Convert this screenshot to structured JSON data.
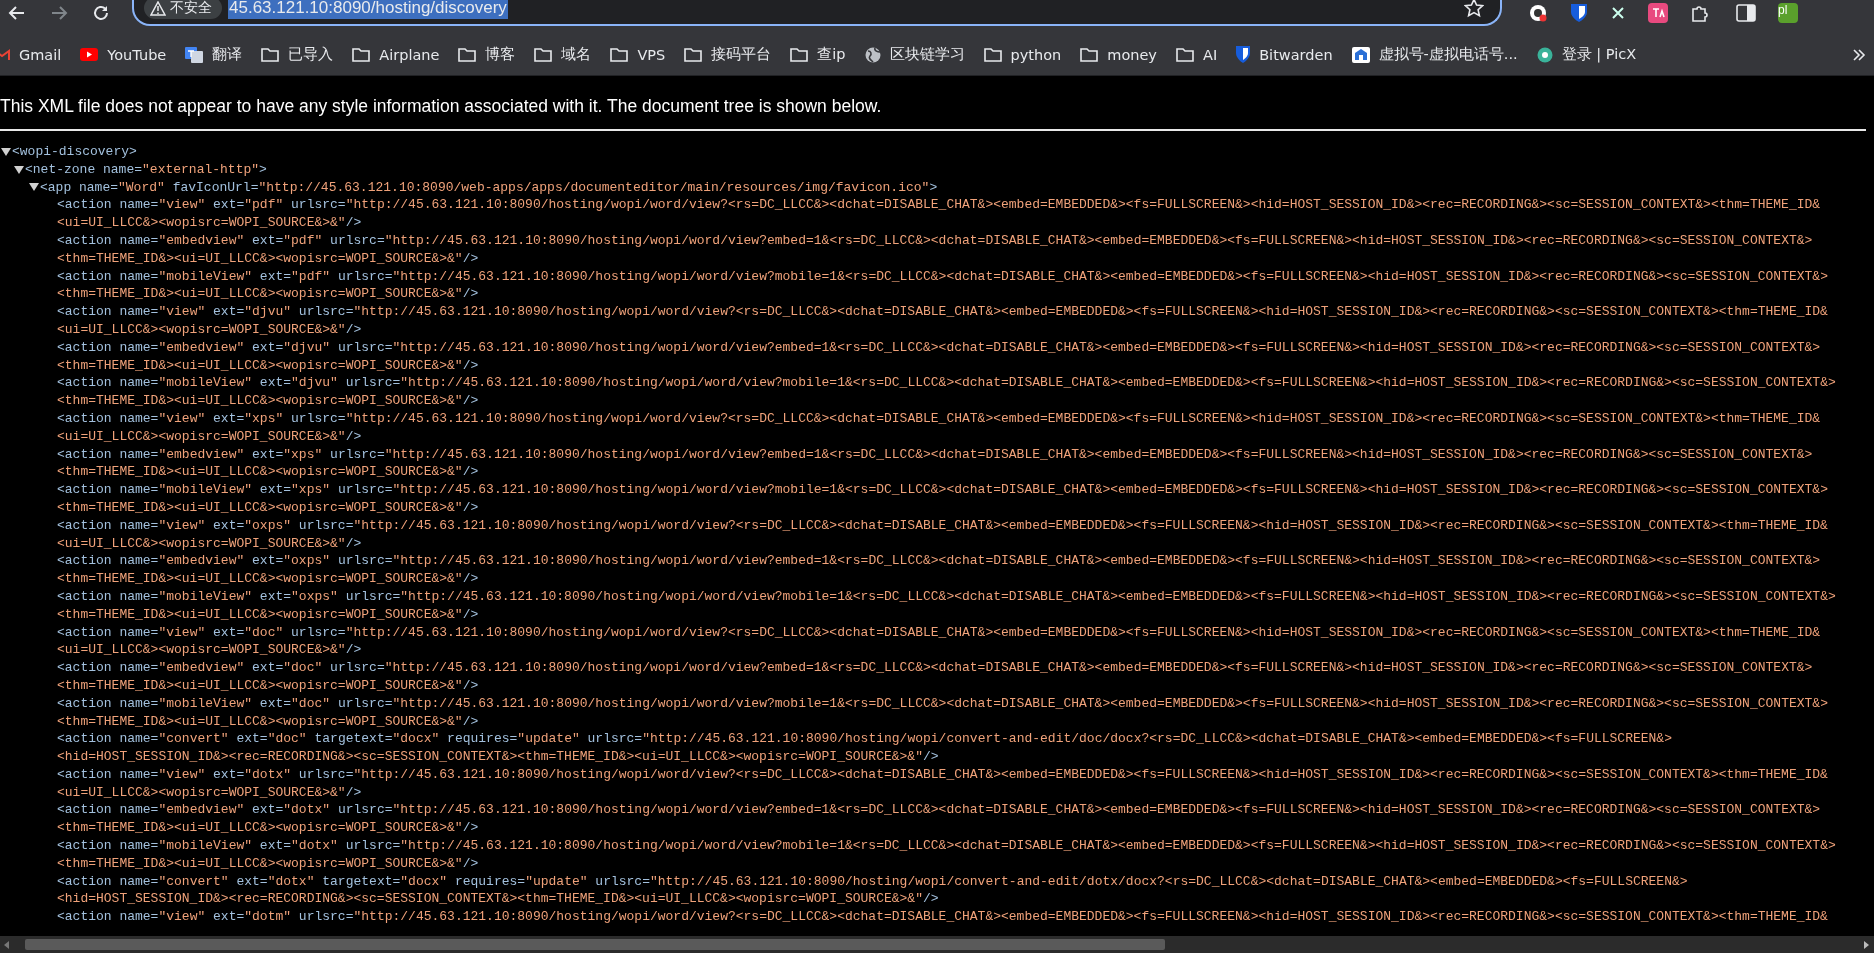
{
  "toolbar": {
    "security_label": "不安全",
    "url": "45.63.121.10:8090/hosting/discovery",
    "url_selected": true,
    "profile_initials": "pl"
  },
  "bookmarks": [
    {
      "label": "Gmail",
      "kind": "gmail"
    },
    {
      "label": "YouTube",
      "kind": "youtube"
    },
    {
      "label": "翻译",
      "kind": "translate"
    },
    {
      "label": "已导入",
      "kind": "folder"
    },
    {
      "label": "Airplane",
      "kind": "folder"
    },
    {
      "label": "博客",
      "kind": "folder"
    },
    {
      "label": "域名",
      "kind": "folder"
    },
    {
      "label": "VPS",
      "kind": "folder"
    },
    {
      "label": "接码平台",
      "kind": "folder"
    },
    {
      "label": "查ip",
      "kind": "folder"
    },
    {
      "label": "区块链学习",
      "kind": "globe"
    },
    {
      "label": "python",
      "kind": "folder"
    },
    {
      "label": "money",
      "kind": "folder"
    },
    {
      "label": "AI",
      "kind": "folder"
    },
    {
      "label": "Bitwarden",
      "kind": "shield"
    },
    {
      "label": "虚拟号-虚拟电话号...",
      "kind": "site"
    },
    {
      "label": "登录 | PicX",
      "kind": "picx"
    }
  ],
  "notice": "This XML file does not appear to have any style information associated with it. The document tree is shown below.",
  "tree": {
    "tag": "<wopi-discovery>",
    "expanded": true,
    "children": [
      {
        "tag": "<net-zone name=\"external-http\">",
        "expanded": true,
        "children": [
          {
            "tag": "<app name=\"Word\" favIconUrl=\"http://45.63.121.10:8090/web-apps/apps/documenteditor/main/resources/img/favicon.ico\">",
            "expanded": true,
            "children": [
              {
                "lines": [
                  "<action name=\"view\" ext=\"pdf\" urlsrc=\"http://45.63.121.10:8090/hosting/wopi/word/view?<rs=DC_LLCC&><dchat=DISABLE_CHAT&><embed=EMBEDDED&><fs=FULLSCREEN&><hid=HOST_SESSION_ID&><rec=RECORDING&><sc=SESSION_CONTEXT&><thm=THEME_ID&",
                  "<ui=UI_LLCC&><wopisrc=WOPI_SOURCE&>&\"/>"
                ]
              },
              {
                "lines": [
                  "<action name=\"embedview\" ext=\"pdf\" urlsrc=\"http://45.63.121.10:8090/hosting/wopi/word/view?embed=1&<rs=DC_LLCC&><dchat=DISABLE_CHAT&><embed=EMBEDDED&><fs=FULLSCREEN&><hid=HOST_SESSION_ID&><rec=RECORDING&><sc=SESSION_CONTEXT&>",
                  "<thm=THEME_ID&><ui=UI_LLCC&><wopisrc=WOPI_SOURCE&>&\"/>"
                ]
              },
              {
                "lines": [
                  "<action name=\"mobileView\" ext=\"pdf\" urlsrc=\"http://45.63.121.10:8090/hosting/wopi/word/view?mobile=1&<rs=DC_LLCC&><dchat=DISABLE_CHAT&><embed=EMBEDDED&><fs=FULLSCREEN&><hid=HOST_SESSION_ID&><rec=RECORDING&><sc=SESSION_CONTEXT&>",
                  "<thm=THEME_ID&><ui=UI_LLCC&><wopisrc=WOPI_SOURCE&>&\"/>"
                ]
              },
              {
                "lines": [
                  "<action name=\"view\" ext=\"djvu\" urlsrc=\"http://45.63.121.10:8090/hosting/wopi/word/view?<rs=DC_LLCC&><dchat=DISABLE_CHAT&><embed=EMBEDDED&><fs=FULLSCREEN&><hid=HOST_SESSION_ID&><rec=RECORDING&><sc=SESSION_CONTEXT&><thm=THEME_ID&",
                  "<ui=UI_LLCC&><wopisrc=WOPI_SOURCE&>&\"/>"
                ]
              },
              {
                "lines": [
                  "<action name=\"embedview\" ext=\"djvu\" urlsrc=\"http://45.63.121.10:8090/hosting/wopi/word/view?embed=1&<rs=DC_LLCC&><dchat=DISABLE_CHAT&><embed=EMBEDDED&><fs=FULLSCREEN&><hid=HOST_SESSION_ID&><rec=RECORDING&><sc=SESSION_CONTEXT&>",
                  "<thm=THEME_ID&><ui=UI_LLCC&><wopisrc=WOPI_SOURCE&>&\"/>"
                ]
              },
              {
                "lines": [
                  "<action name=\"mobileView\" ext=\"djvu\" urlsrc=\"http://45.63.121.10:8090/hosting/wopi/word/view?mobile=1&<rs=DC_LLCC&><dchat=DISABLE_CHAT&><embed=EMBEDDED&><fs=FULLSCREEN&><hid=HOST_SESSION_ID&><rec=RECORDING&><sc=SESSION_CONTEXT&>",
                  "<thm=THEME_ID&><ui=UI_LLCC&><wopisrc=WOPI_SOURCE&>&\"/>"
                ]
              },
              {
                "lines": [
                  "<action name=\"view\" ext=\"xps\" urlsrc=\"http://45.63.121.10:8090/hosting/wopi/word/view?<rs=DC_LLCC&><dchat=DISABLE_CHAT&><embed=EMBEDDED&><fs=FULLSCREEN&><hid=HOST_SESSION_ID&><rec=RECORDING&><sc=SESSION_CONTEXT&><thm=THEME_ID&",
                  "<ui=UI_LLCC&><wopisrc=WOPI_SOURCE&>&\"/>"
                ]
              },
              {
                "lines": [
                  "<action name=\"embedview\" ext=\"xps\" urlsrc=\"http://45.63.121.10:8090/hosting/wopi/word/view?embed=1&<rs=DC_LLCC&><dchat=DISABLE_CHAT&><embed=EMBEDDED&><fs=FULLSCREEN&><hid=HOST_SESSION_ID&><rec=RECORDING&><sc=SESSION_CONTEXT&>",
                  "<thm=THEME_ID&><ui=UI_LLCC&><wopisrc=WOPI_SOURCE&>&\"/>"
                ]
              },
              {
                "lines": [
                  "<action name=\"mobileView\" ext=\"xps\" urlsrc=\"http://45.63.121.10:8090/hosting/wopi/word/view?mobile=1&<rs=DC_LLCC&><dchat=DISABLE_CHAT&><embed=EMBEDDED&><fs=FULLSCREEN&><hid=HOST_SESSION_ID&><rec=RECORDING&><sc=SESSION_CONTEXT&>",
                  "<thm=THEME_ID&><ui=UI_LLCC&><wopisrc=WOPI_SOURCE&>&\"/>"
                ]
              },
              {
                "lines": [
                  "<action name=\"view\" ext=\"oxps\" urlsrc=\"http://45.63.121.10:8090/hosting/wopi/word/view?<rs=DC_LLCC&><dchat=DISABLE_CHAT&><embed=EMBEDDED&><fs=FULLSCREEN&><hid=HOST_SESSION_ID&><rec=RECORDING&><sc=SESSION_CONTEXT&><thm=THEME_ID&",
                  "<ui=UI_LLCC&><wopisrc=WOPI_SOURCE&>&\"/>"
                ]
              },
              {
                "lines": [
                  "<action name=\"embedview\" ext=\"oxps\" urlsrc=\"http://45.63.121.10:8090/hosting/wopi/word/view?embed=1&<rs=DC_LLCC&><dchat=DISABLE_CHAT&><embed=EMBEDDED&><fs=FULLSCREEN&><hid=HOST_SESSION_ID&><rec=RECORDING&><sc=SESSION_CONTEXT&>",
                  "<thm=THEME_ID&><ui=UI_LLCC&><wopisrc=WOPI_SOURCE&>&\"/>"
                ]
              },
              {
                "lines": [
                  "<action name=\"mobileView\" ext=\"oxps\" urlsrc=\"http://45.63.121.10:8090/hosting/wopi/word/view?mobile=1&<rs=DC_LLCC&><dchat=DISABLE_CHAT&><embed=EMBEDDED&><fs=FULLSCREEN&><hid=HOST_SESSION_ID&><rec=RECORDING&><sc=SESSION_CONTEXT&>",
                  "<thm=THEME_ID&><ui=UI_LLCC&><wopisrc=WOPI_SOURCE&>&\"/>"
                ]
              },
              {
                "lines": [
                  "<action name=\"view\" ext=\"doc\" urlsrc=\"http://45.63.121.10:8090/hosting/wopi/word/view?<rs=DC_LLCC&><dchat=DISABLE_CHAT&><embed=EMBEDDED&><fs=FULLSCREEN&><hid=HOST_SESSION_ID&><rec=RECORDING&><sc=SESSION_CONTEXT&><thm=THEME_ID&",
                  "<ui=UI_LLCC&><wopisrc=WOPI_SOURCE&>&\"/>"
                ]
              },
              {
                "lines": [
                  "<action name=\"embedview\" ext=\"doc\" urlsrc=\"http://45.63.121.10:8090/hosting/wopi/word/view?embed=1&<rs=DC_LLCC&><dchat=DISABLE_CHAT&><embed=EMBEDDED&><fs=FULLSCREEN&><hid=HOST_SESSION_ID&><rec=RECORDING&><sc=SESSION_CONTEXT&>",
                  "<thm=THEME_ID&><ui=UI_LLCC&><wopisrc=WOPI_SOURCE&>&\"/>"
                ]
              },
              {
                "lines": [
                  "<action name=\"mobileView\" ext=\"doc\" urlsrc=\"http://45.63.121.10:8090/hosting/wopi/word/view?mobile=1&<rs=DC_LLCC&><dchat=DISABLE_CHAT&><embed=EMBEDDED&><fs=FULLSCREEN&><hid=HOST_SESSION_ID&><rec=RECORDING&><sc=SESSION_CONTEXT&>",
                  "<thm=THEME_ID&><ui=UI_LLCC&><wopisrc=WOPI_SOURCE&>&\"/>"
                ]
              },
              {
                "lines": [
                  "<action name=\"convert\" ext=\"doc\" targetext=\"docx\" requires=\"update\" urlsrc=\"http://45.63.121.10:8090/hosting/wopi/convert-and-edit/doc/docx?<rs=DC_LLCC&><dchat=DISABLE_CHAT&><embed=EMBEDDED&><fs=FULLSCREEN&>",
                  "<hid=HOST_SESSION_ID&><rec=RECORDING&><sc=SESSION_CONTEXT&><thm=THEME_ID&><ui=UI_LLCC&><wopisrc=WOPI_SOURCE&>&\"/>"
                ]
              },
              {
                "lines": [
                  "<action name=\"view\" ext=\"dotx\" urlsrc=\"http://45.63.121.10:8090/hosting/wopi/word/view?<rs=DC_LLCC&><dchat=DISABLE_CHAT&><embed=EMBEDDED&><fs=FULLSCREEN&><hid=HOST_SESSION_ID&><rec=RECORDING&><sc=SESSION_CONTEXT&><thm=THEME_ID&",
                  "<ui=UI_LLCC&><wopisrc=WOPI_SOURCE&>&\"/>"
                ]
              },
              {
                "lines": [
                  "<action name=\"embedview\" ext=\"dotx\" urlsrc=\"http://45.63.121.10:8090/hosting/wopi/word/view?embed=1&<rs=DC_LLCC&><dchat=DISABLE_CHAT&><embed=EMBEDDED&><fs=FULLSCREEN&><hid=HOST_SESSION_ID&><rec=RECORDING&><sc=SESSION_CONTEXT&>",
                  "<thm=THEME_ID&><ui=UI_LLCC&><wopisrc=WOPI_SOURCE&>&\"/>"
                ]
              },
              {
                "lines": [
                  "<action name=\"mobileView\" ext=\"dotx\" urlsrc=\"http://45.63.121.10:8090/hosting/wopi/word/view?mobile=1&<rs=DC_LLCC&><dchat=DISABLE_CHAT&><embed=EMBEDDED&><fs=FULLSCREEN&><hid=HOST_SESSION_ID&><rec=RECORDING&><sc=SESSION_CONTEXT&>",
                  "<thm=THEME_ID&><ui=UI_LLCC&><wopisrc=WOPI_SOURCE&>&\"/>"
                ]
              },
              {
                "lines": [
                  "<action name=\"convert\" ext=\"dotx\" targetext=\"docx\" requires=\"update\" urlsrc=\"http://45.63.121.10:8090/hosting/wopi/convert-and-edit/dotx/docx?<rs=DC_LLCC&><dchat=DISABLE_CHAT&><embed=EMBEDDED&><fs=FULLSCREEN&>",
                  "<hid=HOST_SESSION_ID&><rec=RECORDING&><sc=SESSION_CONTEXT&><thm=THEME_ID&><ui=UI_LLCC&><wopisrc=WOPI_SOURCE&>&\"/>"
                ]
              },
              {
                "lines": [
                  "<action name=\"view\" ext=\"dotm\" urlsrc=\"http://45.63.121.10:8090/hosting/wopi/word/view?<rs=DC_LLCC&><dchat=DISABLE_CHAT&><embed=EMBEDDED&><fs=FULLSCREEN&><hid=HOST_SESSION_ID&><rec=RECORDING&><sc=SESSION_CONTEXT&><thm=THEME_ID&"
                ]
              }
            ]
          }
        ]
      }
    ]
  }
}
